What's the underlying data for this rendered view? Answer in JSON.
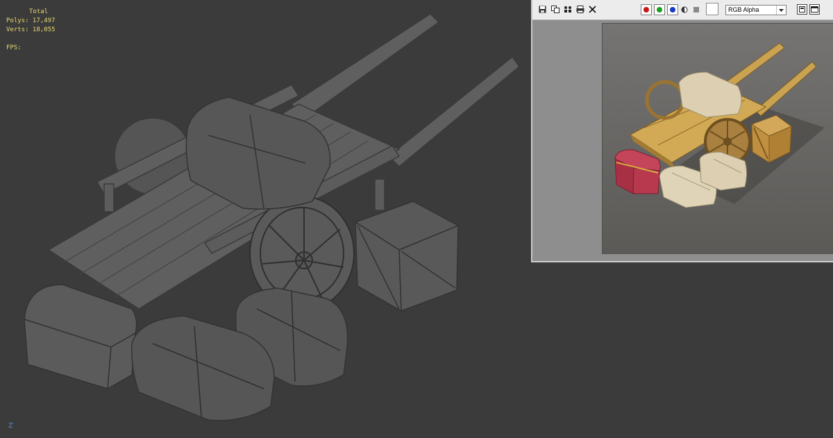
{
  "viewport": {
    "stats": {
      "total_label": "Total",
      "polys": "Polys: 17,497",
      "verts": "Verts: 18,055",
      "fps": "FPS:"
    },
    "axis_label": "Z"
  },
  "frame_buffer": {
    "toolbar": {
      "save_icon": "save-icon",
      "copy_icon": "copy-icon",
      "clone_icon": "clone-icon",
      "print_icon": "print-icon",
      "clear_icon": "clear-icon",
      "channels": [
        {
          "name": "red",
          "color": "#c81818"
        },
        {
          "name": "green",
          "color": "#18a018"
        },
        {
          "name": "blue",
          "color": "#1838c8"
        }
      ],
      "display_channel": "RGB Alpha"
    },
    "colors": {
      "viewport_bg": "#3b3b3b",
      "model_gray": "#5f5f5f",
      "render_bg": "#6d6b68",
      "wood": "#c49a45",
      "chest": "#b03a4a",
      "sack": "#d8ccb0"
    }
  }
}
